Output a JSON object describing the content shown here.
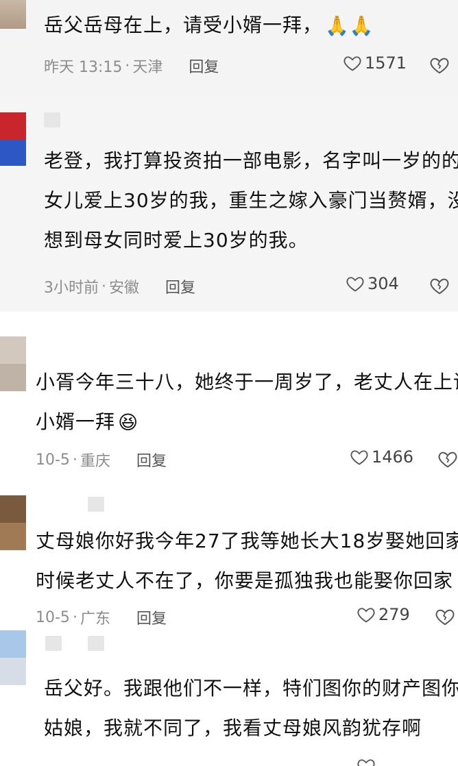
{
  "comments": [
    {
      "lines": [
        "岳父岳母在上，请受小婿一拜，"
      ],
      "emoji": "🙏🙏",
      "time": "昨天 13:15",
      "location": "天津",
      "reply_label": "回复",
      "likes": "1571"
    },
    {
      "lines": [
        "老登，我打算投资拍一部电影，名字叫一岁的的",
        "女儿爱上30岁的我，重生之嫁入豪门当赘婿，没",
        "想到母女同时爱上30岁的我。"
      ],
      "time": "3小时前",
      "location": "安徽",
      "reply_label": "回复",
      "likes": "304"
    },
    {
      "lines": [
        "小胥今年三十八，她终于一周岁了，老丈人在上请受",
        "小婿一拜"
      ],
      "emoji": "😆",
      "time": "10-5",
      "location": "重庆",
      "reply_label": "回复",
      "likes": "1466"
    },
    {
      "lines": [
        "丈母娘你好我今年27了我等她长大18岁娶她回家，到",
        "时候老丈人不在了，你要是孤独我也能娶你回家"
      ],
      "emoji": "🌹",
      "time": "10-5",
      "location": "广东",
      "reply_label": "回复",
      "likes": "279"
    },
    {
      "lines": [
        "岳父好。我跟他们不一样，特们图你的财产图你",
        "姑娘，我就不同了，我看丈母娘风韵犹存啊"
      ]
    }
  ],
  "colors": {
    "heart": "#555555",
    "meta": "#8c8c8c",
    "band": "#f5f5f5"
  },
  "icons": {
    "like": "heart-outline-icon",
    "dislike": "broken-heart-icon"
  }
}
